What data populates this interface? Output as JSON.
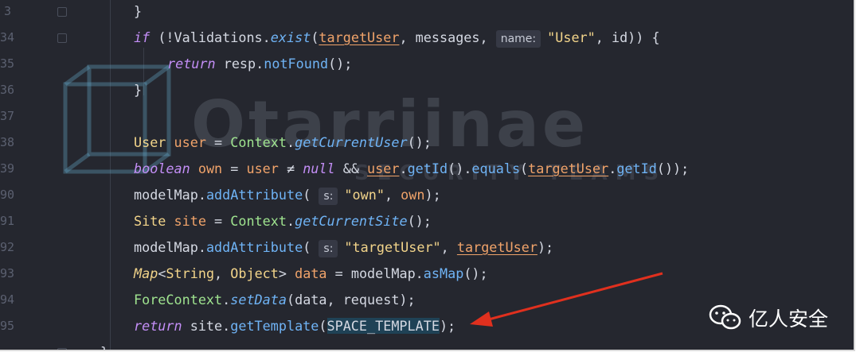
{
  "editor": {
    "line_numbers": [
      "3",
      "34",
      "35",
      "36",
      "37",
      "38",
      "39",
      "90",
      "91",
      "92",
      "93",
      "94",
      "95",
      ""
    ],
    "lines": [
      {
        "tokens": [
          {
            "t": "}",
            "c": "pl"
          }
        ]
      },
      {
        "tokens": [
          {
            "t": "if",
            "c": "kw"
          },
          {
            "t": " (!Validations.",
            "c": "pl"
          },
          {
            "t": "exist",
            "c": "fni"
          },
          {
            "t": "(",
            "c": "pl"
          },
          {
            "t": "targetUser",
            "c": "var-u"
          },
          {
            "t": ", messages, ",
            "c": "pl"
          },
          {
            "t": "name:",
            "c": "hint"
          },
          {
            "t": "\"User\"",
            "c": "str"
          },
          {
            "t": ", id)) {",
            "c": "pl"
          }
        ]
      },
      {
        "tokens": [
          {
            "t": "return",
            "c": "kw"
          },
          {
            "t": " resp.",
            "c": "pl"
          },
          {
            "t": "notFound",
            "c": "fn"
          },
          {
            "t": "();",
            "c": "pl"
          }
        ]
      },
      {
        "tokens": [
          {
            "t": "}",
            "c": "pl"
          }
        ]
      },
      {
        "tokens": []
      },
      {
        "tokens": [
          {
            "t": "User",
            "c": "ty"
          },
          {
            "t": " ",
            "c": "pl"
          },
          {
            "t": "user",
            "c": "var"
          },
          {
            "t": " = ",
            "c": "pl"
          },
          {
            "t": "Context",
            "c": "gr"
          },
          {
            "t": ".",
            "c": "pl"
          },
          {
            "t": "getCurrentUser",
            "c": "fni"
          },
          {
            "t": "();",
            "c": "pl"
          }
        ]
      },
      {
        "tokens": [
          {
            "t": "boolean",
            "c": "kw"
          },
          {
            "t": " ",
            "c": "pl"
          },
          {
            "t": "own",
            "c": "var"
          },
          {
            "t": " = ",
            "c": "pl"
          },
          {
            "t": "user",
            "c": "var"
          },
          {
            "t": " ≠ ",
            "c": "pl"
          },
          {
            "t": "null",
            "c": "kw"
          },
          {
            "t": " && ",
            "c": "pl"
          },
          {
            "t": "user",
            "c": "var-u"
          },
          {
            "t": ".",
            "c": "pl"
          },
          {
            "t": "getId",
            "c": "fn"
          },
          {
            "t": "().",
            "c": "pl"
          },
          {
            "t": "equals",
            "c": "fn"
          },
          {
            "t": "(",
            "c": "pl"
          },
          {
            "t": "targetUser",
            "c": "var-u"
          },
          {
            "t": ".",
            "c": "pl"
          },
          {
            "t": "getId",
            "c": "fn"
          },
          {
            "t": "());",
            "c": "pl"
          }
        ]
      },
      {
        "tokens": [
          {
            "t": "modelMap.",
            "c": "pl"
          },
          {
            "t": "addAttribute",
            "c": "fn"
          },
          {
            "t": "( ",
            "c": "pl"
          },
          {
            "t": "s:",
            "c": "hint"
          },
          {
            "t": "\"own\"",
            "c": "str"
          },
          {
            "t": ", ",
            "c": "pl"
          },
          {
            "t": "own",
            "c": "var"
          },
          {
            "t": ");",
            "c": "pl"
          }
        ]
      },
      {
        "tokens": [
          {
            "t": "Site",
            "c": "ty"
          },
          {
            "t": " ",
            "c": "pl"
          },
          {
            "t": "site",
            "c": "var"
          },
          {
            "t": " = ",
            "c": "pl"
          },
          {
            "t": "Context",
            "c": "gr"
          },
          {
            "t": ".",
            "c": "pl"
          },
          {
            "t": "getCurrentSite",
            "c": "fni"
          },
          {
            "t": "();",
            "c": "pl"
          }
        ]
      },
      {
        "tokens": [
          {
            "t": "modelMap.",
            "c": "pl"
          },
          {
            "t": "addAttribute",
            "c": "fn"
          },
          {
            "t": "( ",
            "c": "pl"
          },
          {
            "t": "s:",
            "c": "hint"
          },
          {
            "t": "\"targetUser\"",
            "c": "str"
          },
          {
            "t": ", ",
            "c": "pl"
          },
          {
            "t": "targetUser",
            "c": "var-u"
          },
          {
            "t": ");",
            "c": "pl"
          }
        ]
      },
      {
        "tokens": [
          {
            "t": "Map",
            "c": "tyi"
          },
          {
            "t": "<",
            "c": "pl"
          },
          {
            "t": "String",
            "c": "ty"
          },
          {
            "t": ", ",
            "c": "pl"
          },
          {
            "t": "Object",
            "c": "ty"
          },
          {
            "t": "> ",
            "c": "pl"
          },
          {
            "t": "data",
            "c": "var"
          },
          {
            "t": " = modelMap.",
            "c": "pl"
          },
          {
            "t": "asMap",
            "c": "fn"
          },
          {
            "t": "();",
            "c": "pl"
          }
        ]
      },
      {
        "tokens": [
          {
            "t": "ForeContext",
            "c": "gr"
          },
          {
            "t": ".",
            "c": "pl"
          },
          {
            "t": "setData",
            "c": "fni"
          },
          {
            "t": "(data, request);",
            "c": "pl"
          }
        ]
      },
      {
        "tokens": [
          {
            "t": "return",
            "c": "kw"
          },
          {
            "t": " site.",
            "c": "pl"
          },
          {
            "t": "getTemplate",
            "c": "fn"
          },
          {
            "t": "(",
            "c": "pl"
          },
          {
            "t": "SPACE_TEMPLATE",
            "c": "hl"
          },
          {
            "t": ");",
            "c": "pl"
          }
        ]
      },
      {
        "tokens": [
          {
            "t": "}",
            "c": "pl"
          }
        ]
      }
    ]
  },
  "watermark": {
    "title": "Otarriinae",
    "subtitle": "SECURITY TEAMS"
  },
  "brand": {
    "icon": "wechat-icon",
    "name": "亿人安全"
  },
  "colors": {
    "background": "#25272f",
    "annotation_arrow": "#e0301e"
  }
}
